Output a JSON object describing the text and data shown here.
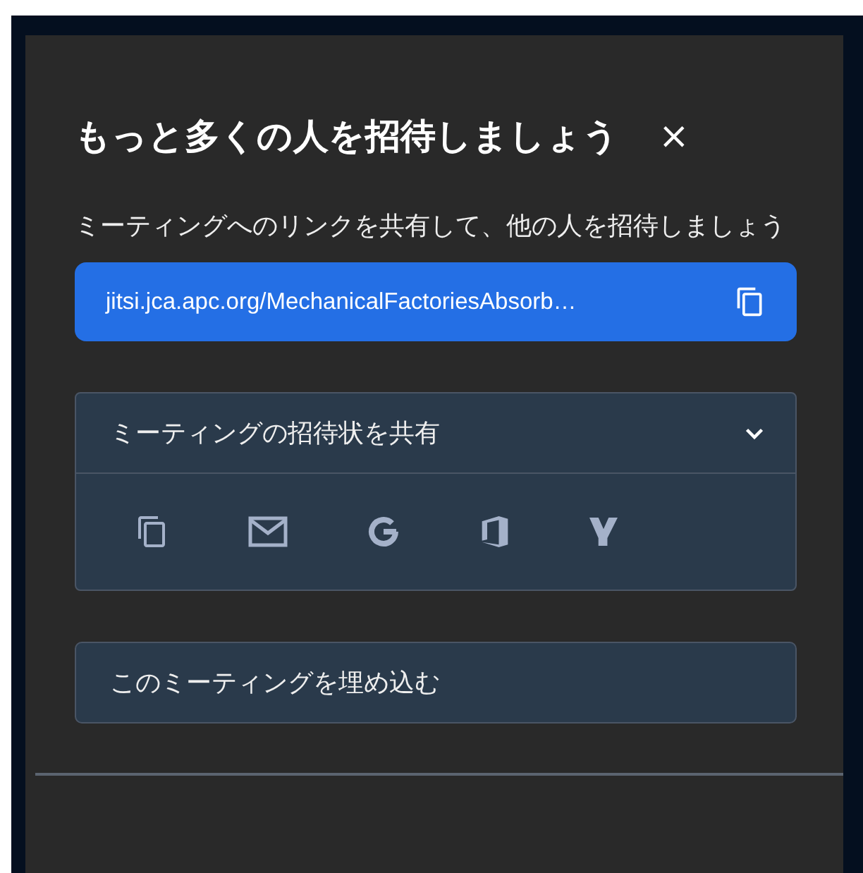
{
  "dialog": {
    "title": "もっと多くの人を招待しましょう",
    "close": "×"
  },
  "description": "ミーティングへのリンクを共有して、他の人を招待しましょう",
  "link": {
    "url": "jitsi.jca.apc.org/MechanicalFactoriesAbsorb…"
  },
  "invite_share": {
    "label": "ミーティングの招待状を共有",
    "expanded": true,
    "options": [
      {
        "kind": "copy"
      },
      {
        "kind": "email"
      },
      {
        "kind": "google"
      },
      {
        "kind": "office"
      },
      {
        "kind": "yahoo"
      }
    ]
  },
  "embed": {
    "label": "このミーティングを埋め込む"
  }
}
